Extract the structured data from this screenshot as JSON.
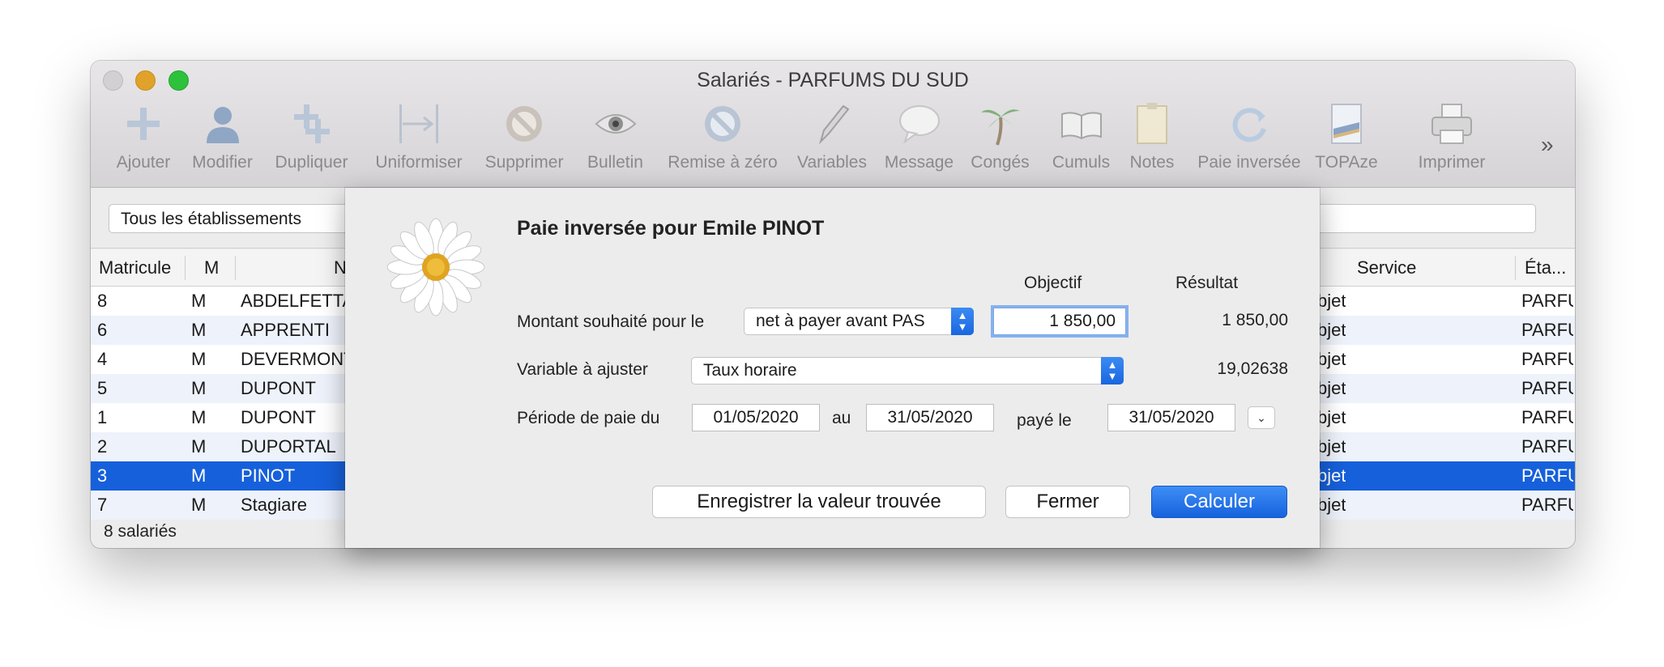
{
  "window": {
    "title": "Salariés - PARFUMS DU SUD"
  },
  "toolbar": {
    "items": [
      {
        "label": "Ajouter",
        "icon": "plus-icon"
      },
      {
        "label": "Modifier",
        "icon": "person-icon"
      },
      {
        "label": "Dupliquer",
        "icon": "duplicate-icon"
      },
      {
        "label": "Uniformiser",
        "icon": "uniformize-icon"
      },
      {
        "label": "Supprimer",
        "icon": "forbidden-icon"
      },
      {
        "label": "Bulletin",
        "icon": "eye-icon"
      },
      {
        "label": "Remise à zéro",
        "icon": "reset-icon"
      },
      {
        "label": "Variables",
        "icon": "pencil-icon"
      },
      {
        "label": "Message",
        "icon": "speech-bubble-icon"
      },
      {
        "label": "Congés",
        "icon": "palm-tree-icon"
      },
      {
        "label": "Cumuls",
        "icon": "book-icon"
      },
      {
        "label": "Notes",
        "icon": "note-icon"
      },
      {
        "label": "Paie inversée",
        "icon": "refresh-icon"
      },
      {
        "label": "TOPAze",
        "icon": "document-icon"
      },
      {
        "label": "Imprimer",
        "icon": "printer-icon"
      }
    ],
    "more": "»"
  },
  "filter": {
    "etablissement": "Tous les établissements"
  },
  "table": {
    "headers": {
      "matricule": "Matricule",
      "m": "M",
      "nom": "N",
      "service": "Service",
      "etab": "Éta..."
    },
    "rows": [
      {
        "matricule": "8",
        "m": "M",
        "nom": "ABDELFETTA",
        "service": "bjet",
        "etab": "PARFU"
      },
      {
        "matricule": "6",
        "m": "M",
        "nom": "APPRENTI",
        "service": "bjet",
        "etab": "PARFU"
      },
      {
        "matricule": "4",
        "m": "M",
        "nom": "DEVERMONT",
        "service": "bjet",
        "etab": "PARFU"
      },
      {
        "matricule": "5",
        "m": "M",
        "nom": "DUPONT",
        "service": "bjet",
        "etab": "PARFU"
      },
      {
        "matricule": "1",
        "m": "M",
        "nom": "DUPONT",
        "service": "bjet",
        "etab": "PARFU"
      },
      {
        "matricule": "2",
        "m": "M",
        "nom": "DUPORTAL",
        "service": "bjet",
        "etab": "PARFU"
      },
      {
        "matricule": "3",
        "m": "M",
        "nom": "PINOT",
        "service": "bjet",
        "etab": "PARFU",
        "selected": true
      },
      {
        "matricule": "7",
        "m": "M",
        "nom": "Stagiare",
        "service": "bjet",
        "etab": "PARFU"
      }
    ],
    "footer": "8 salariés"
  },
  "dialog": {
    "title": "Paie inversée pour Emile PINOT",
    "col_objectif": "Objectif",
    "col_resultat": "Résultat",
    "montant_label": "Montant souhaité pour le",
    "montant_select": "net à payer avant PAS",
    "objectif_value": "1 850,00",
    "resultat_montant": "1 850,00",
    "variable_label": "Variable à ajuster",
    "variable_select": "Taux horaire",
    "resultat_variable": "19,02638",
    "periode_label": "Période de paie du",
    "date_debut": "01/05/2020",
    "au_label": "au",
    "date_fin": "31/05/2020",
    "paye_label": "payé le",
    "date_paiement": "31/05/2020",
    "btn_enregistrer": "Enregistrer la valeur trouvée",
    "btn_fermer": "Fermer",
    "btn_calculer": "Calculer"
  },
  "colors": {
    "selection": "#1660db",
    "primary_button": "#1a66e0",
    "alt_row": "#eef2fb"
  }
}
